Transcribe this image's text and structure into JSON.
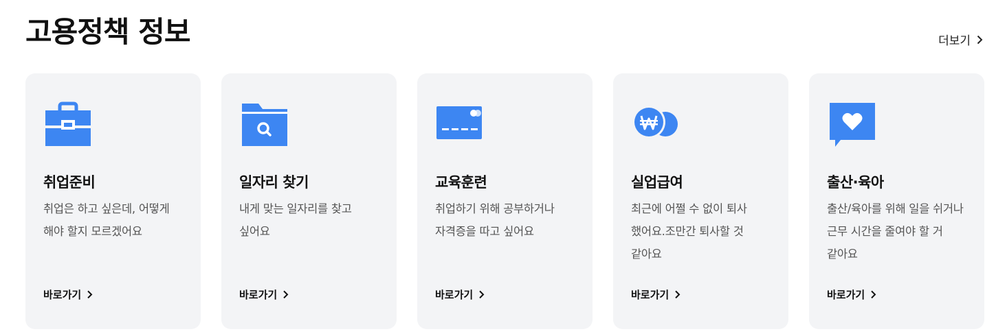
{
  "section": {
    "title": "고용정책 정보",
    "more_label": "더보기"
  },
  "accent_color": "#3d86f2",
  "card_background": "#f3f4f6",
  "cards": [
    {
      "icon": "briefcase-icon",
      "title": "취업준비",
      "description": "취업은 하고 싶은데, 어떻게 해야 할지 모르겠어요",
      "link_label": "바로가기"
    },
    {
      "icon": "folder-search-icon",
      "title": "일자리 찾기",
      "description": "내게 맞는 일자리를 찾고 싶어요",
      "link_label": "바로가기"
    },
    {
      "icon": "credit-card-icon",
      "title": "교육훈련",
      "description": "취업하기 위해 공부하거나 자격증을 따고 싶어요",
      "link_label": "바로가기"
    },
    {
      "icon": "won-coin-icon",
      "title": "실업급여",
      "description": "최근에 어쩔 수 없이 퇴사 했어요.조만간 퇴사할 것 같아요",
      "link_label": "바로가기"
    },
    {
      "icon": "heart-message-icon",
      "title": "출산·육아",
      "description": "출산/육아를 위해 일을 쉬거나 근무 시간을 줄여야 할 거 같아요",
      "link_label": "바로가기"
    }
  ]
}
